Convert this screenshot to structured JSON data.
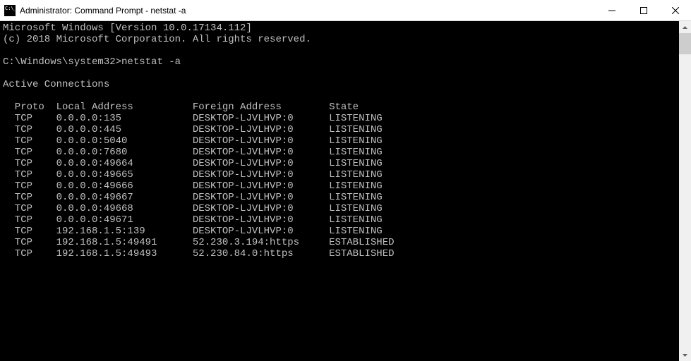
{
  "window": {
    "title": "Administrator: Command Prompt - netstat  -a"
  },
  "terminal": {
    "line_version": "Microsoft Windows [Version 10.0.17134.112]",
    "line_copyright": "(c) 2018 Microsoft Corporation. All rights reserved.",
    "prompt": "C:\\Windows\\system32>",
    "command": "netstat -a",
    "header_active": "Active Connections",
    "columns": {
      "proto": "Proto",
      "local": "Local Address",
      "foreign": "Foreign Address",
      "state": "State"
    },
    "rows": [
      {
        "proto": "TCP",
        "local": "0.0.0.0:135",
        "foreign": "DESKTOP-LJVLHVP:0",
        "state": "LISTENING"
      },
      {
        "proto": "TCP",
        "local": "0.0.0.0:445",
        "foreign": "DESKTOP-LJVLHVP:0",
        "state": "LISTENING"
      },
      {
        "proto": "TCP",
        "local": "0.0.0.0:5040",
        "foreign": "DESKTOP-LJVLHVP:0",
        "state": "LISTENING"
      },
      {
        "proto": "TCP",
        "local": "0.0.0.0:7680",
        "foreign": "DESKTOP-LJVLHVP:0",
        "state": "LISTENING"
      },
      {
        "proto": "TCP",
        "local": "0.0.0.0:49664",
        "foreign": "DESKTOP-LJVLHVP:0",
        "state": "LISTENING"
      },
      {
        "proto": "TCP",
        "local": "0.0.0.0:49665",
        "foreign": "DESKTOP-LJVLHVP:0",
        "state": "LISTENING"
      },
      {
        "proto": "TCP",
        "local": "0.0.0.0:49666",
        "foreign": "DESKTOP-LJVLHVP:0",
        "state": "LISTENING"
      },
      {
        "proto": "TCP",
        "local": "0.0.0.0:49667",
        "foreign": "DESKTOP-LJVLHVP:0",
        "state": "LISTENING"
      },
      {
        "proto": "TCP",
        "local": "0.0.0.0:49668",
        "foreign": "DESKTOP-LJVLHVP:0",
        "state": "LISTENING"
      },
      {
        "proto": "TCP",
        "local": "0.0.0.0:49671",
        "foreign": "DESKTOP-LJVLHVP:0",
        "state": "LISTENING"
      },
      {
        "proto": "TCP",
        "local": "192.168.1.5:139",
        "foreign": "DESKTOP-LJVLHVP:0",
        "state": "LISTENING"
      },
      {
        "proto": "TCP",
        "local": "192.168.1.5:49491",
        "foreign": "52.230.3.194:https",
        "state": "ESTABLISHED"
      },
      {
        "proto": "TCP",
        "local": "192.168.1.5:49493",
        "foreign": "52.230.84.0:https",
        "state": "ESTABLISHED"
      }
    ]
  }
}
